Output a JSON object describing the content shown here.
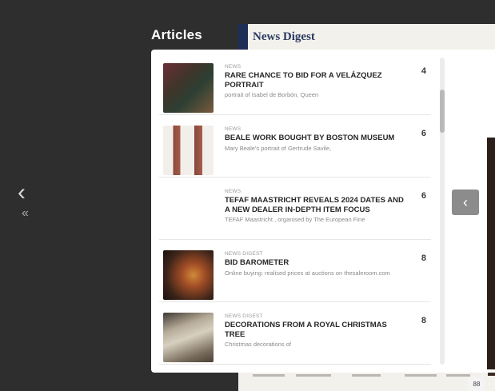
{
  "background": {
    "magazine_title": "News Digest"
  },
  "navigation": {
    "prev_icon": "chevron-left-icon",
    "first_icon": "double-chevron-left-icon",
    "prev_glyph": "‹",
    "first_glyph": "«",
    "back_glyph": "‹",
    "corner_glyph": "88"
  },
  "panel": {
    "title": "Articles"
  },
  "articles": [
    {
      "kicker": "NEWS",
      "headline": "RARE CHANCE TO BID FOR A VELÁZQUEZ PORTRAIT",
      "summary": "portrait of Isabel de Borbón, Queen",
      "page": "4",
      "has_thumb": true
    },
    {
      "kicker": "NEWS",
      "headline": "BEALE WORK BOUGHT BY BOSTON MUSEUM",
      "summary": "Mary Beale's portrait of Gertrude Savile,",
      "page": "6",
      "has_thumb": true
    },
    {
      "kicker": "NEWS",
      "headline": "TEFAF MAASTRICHT REVEALS 2024 DATES AND A NEW DEALER IN-DEPTH ITEM FOCUS",
      "summary": "TEFAF Maastricht , organised by The European Fine",
      "page": "6",
      "has_thumb": false
    },
    {
      "kicker": "NEWS DIGEST",
      "headline": "BID BAROMETER",
      "summary": "Online buying: realised prices at auctions on thesaleroom.com",
      "page": "8",
      "has_thumb": true
    },
    {
      "kicker": "NEWS DIGEST",
      "headline": "DECORATIONS FROM A ROYAL CHRISTMAS TREE",
      "summary": "Christmas decorations of",
      "page": "8",
      "has_thumb": true
    }
  ],
  "colors": {
    "overlay_bg": "#ffffff",
    "backdrop": "#2e2e2e",
    "back_button": "#8c8c8c"
  }
}
